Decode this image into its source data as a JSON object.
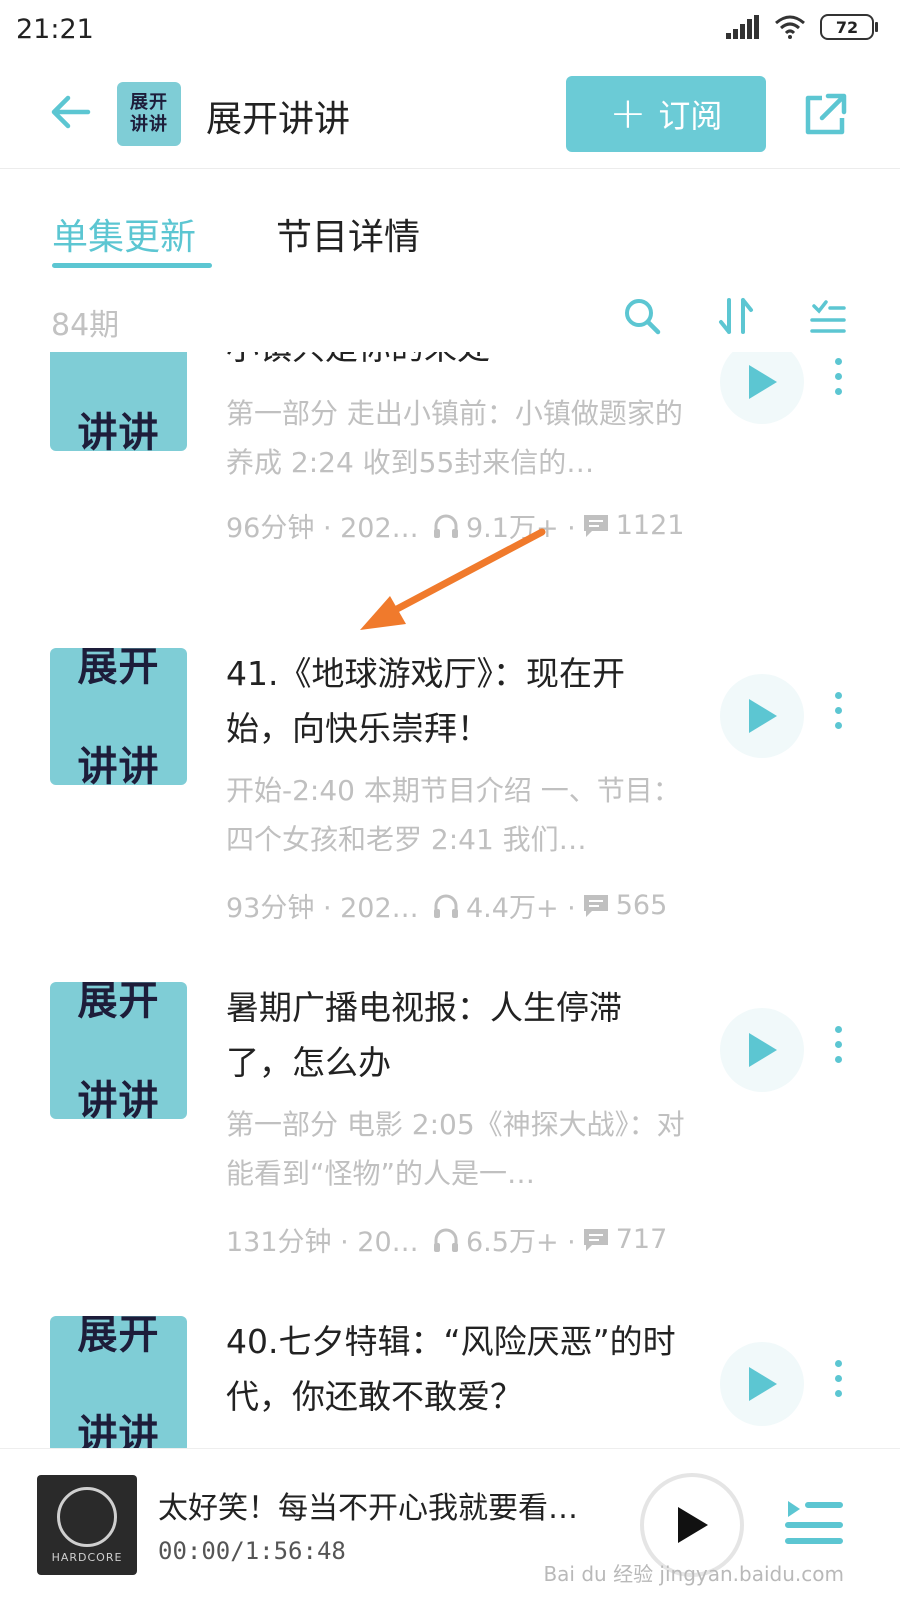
{
  "status": {
    "time": "21:21",
    "battery": "72"
  },
  "header": {
    "title": "展开讲讲",
    "logo_text": [
      "展开",
      "讲讲"
    ],
    "subscribe_label": "订阅"
  },
  "tabs": {
    "active": "单集更新",
    "inactive": "节目详情"
  },
  "toolbar": {
    "count": "84期"
  },
  "episodes": [
    {
      "title": "小镇只是你的来处",
      "desc": "第一部分 走出小镇前：小镇做题家的养成 2:24 收到55封来信的…",
      "duration": "96分钟 · 202…",
      "plays": "9.1万+ ·",
      "comments": "1121"
    },
    {
      "title": "41.《地球游戏厅》：现在开始，向快乐崇拜！",
      "desc": "开始-2:40 本期节目介绍 一、节目：四个女孩和老罗 2:41 我们…",
      "duration": "93分钟 · 2022…",
      "plays": "4.4万+ ·",
      "comments": "565"
    },
    {
      "title": "暑期广播电视报：人生停滞了，怎么办",
      "desc": "第一部分 电影 2:05《神探大战》：对能看到“怪物”的人是一…",
      "duration": "131分钟 · 202…",
      "plays": "6.5万+ ·",
      "comments": "717"
    },
    {
      "title": "40.七夕特辑：“风险厌恶”的时代，你还敢不敢爱？",
      "desc": "",
      "duration": "",
      "plays": "",
      "comments": ""
    }
  ],
  "player": {
    "title": "太好笑！每当不开心我就要看…",
    "time": "00:00/1:56:48",
    "cover_text": "HARDCORE"
  },
  "watermark": "Bai du 经验 jingyan.baidu.com",
  "colors": {
    "accent": "#5cc6d2",
    "subscribe_bg": "#6bcbd6",
    "logo_bg": "#7fcdd6",
    "arrow": "#f07a2c"
  }
}
